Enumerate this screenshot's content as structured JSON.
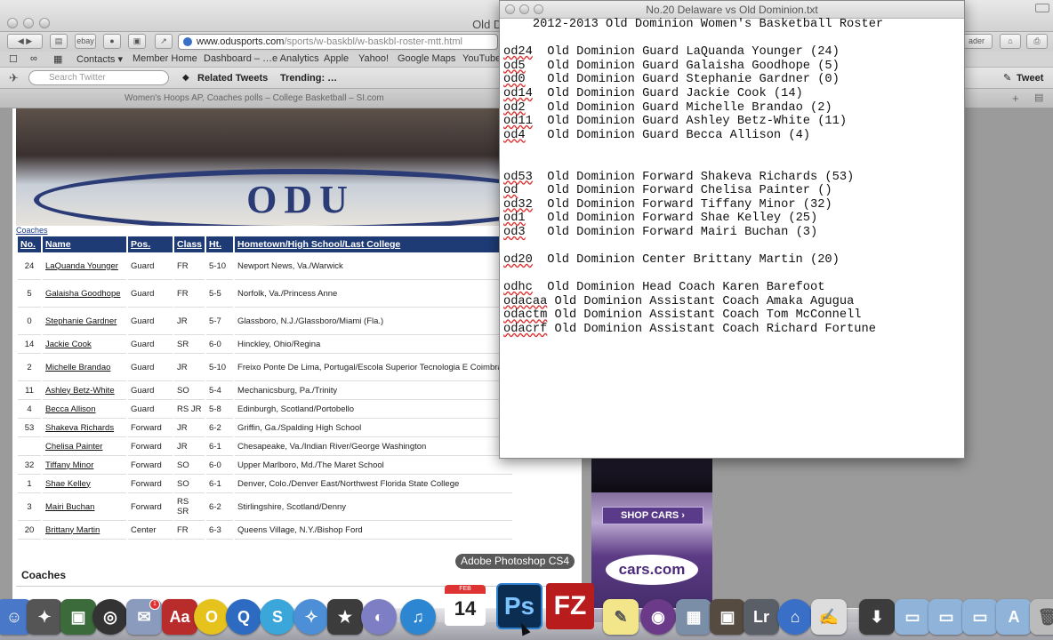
{
  "browser": {
    "window_title": "Old Dominion Official",
    "url_host": "www.odusports.com",
    "url_path": "/sports/w-baskbl/w-baskbl-roster-mtt.html",
    "bookmarks": [
      "Contacts ▾",
      "Member Home",
      "Dashboard – …e Analytics",
      "Apple",
      "Yahoo!",
      "Google Maps",
      "YouTube"
    ],
    "twitter_search_placeholder": "Search Twitter",
    "related_tweets": "Related Tweets",
    "trending": "Trending: …",
    "tweet_button": "Tweet",
    "tab_title": "Women's Hoops AP, Coaches polls – College Basketball – SI.com",
    "reader_label": "ader"
  },
  "page": {
    "coaches_link": "Coaches",
    "table_headers": [
      "No.",
      "Name",
      "Pos.",
      "Class",
      "Ht.",
      "Hometown/High School/Last College"
    ],
    "roster": [
      {
        "no": "24",
        "name": "LaQuanda Younger",
        "pos": "Guard",
        "class": "FR",
        "ht": "5-10",
        "hometown": "Newport News, Va./Warwick"
      },
      {
        "no": "5",
        "name": "Galaisha Goodhope",
        "pos": "Guard",
        "class": "FR",
        "ht": "5-5",
        "hometown": "Norfolk, Va./Princess Anne"
      },
      {
        "no": "0",
        "name": "Stephanie Gardner",
        "pos": "Guard",
        "class": "JR",
        "ht": "5-7",
        "hometown": "Glassboro, N.J./Glassboro/Miami (Fla.)"
      },
      {
        "no": "14",
        "name": "Jackie Cook",
        "pos": "Guard",
        "class": "SR",
        "ht": "6-0",
        "hometown": "Hinckley, Ohio/Regina"
      },
      {
        "no": "2",
        "name": "Michelle Brandao",
        "pos": "Guard",
        "class": "JR",
        "ht": "5-10",
        "hometown": "Freixo Ponte De Lima, Portugal/Escola Superior Tecnologia E Coimbra"
      },
      {
        "no": "11",
        "name": "Ashley Betz-White",
        "pos": "Guard",
        "class": "SO",
        "ht": "5-4",
        "hometown": "Mechanicsburg, Pa./Trinity"
      },
      {
        "no": "4",
        "name": "Becca Allison",
        "pos": "Guard",
        "class": "RS JR",
        "ht": "5-8",
        "hometown": "Edinburgh, Scotland/Portobello"
      },
      {
        "no": "53",
        "name": "Shakeva Richards",
        "pos": "Forward",
        "class": "JR",
        "ht": "6-2",
        "hometown": "Griffin, Ga./Spalding High School"
      },
      {
        "no": "",
        "name": "Chelisa Painter",
        "pos": "Forward",
        "class": "JR",
        "ht": "6-1",
        "hometown": "Chesapeake, Va./Indian River/George Washington"
      },
      {
        "no": "32",
        "name": "Tiffany Minor",
        "pos": "Forward",
        "class": "SO",
        "ht": "6-0",
        "hometown": "Upper Marlboro, Md./The Maret School"
      },
      {
        "no": "1",
        "name": "Shae Kelley",
        "pos": "Forward",
        "class": "SO",
        "ht": "6-1",
        "hometown": "Denver, Colo./Denver East/Northwest Florida State College"
      },
      {
        "no": "3",
        "name": "Mairi Buchan",
        "pos": "Forward",
        "class": "RS SR",
        "ht": "6-2",
        "hometown": "Stirlingshire, Scotland/Denny"
      },
      {
        "no": "20",
        "name": "Brittany Martin",
        "pos": "Center",
        "class": "FR",
        "ht": "6-3",
        "hometown": "Queens Village, N.Y./Bishop Ford"
      }
    ],
    "coaches_heading": "Coaches",
    "ad_button": "SHOP CARS ›",
    "ad_logo": "cars.com"
  },
  "editor": {
    "title": "No.20 Delaware vs Old Dominion.txt",
    "lines": [
      {
        "text": "    2012-2013 Old Dominion Women's Basketball Roster",
        "code": ""
      },
      {
        "text": "",
        "code": ""
      },
      {
        "code": "od24",
        "text": "  Old Dominion Guard LaQuanda Younger (24)"
      },
      {
        "code": "od5",
        "text": "   Old Dominion Guard Galaisha Goodhope (5)"
      },
      {
        "code": "od0",
        "text": "   Old Dominion Guard Stephanie Gardner (0)"
      },
      {
        "code": "od14",
        "text": "  Old Dominion Guard Jackie Cook (14)"
      },
      {
        "code": "od2",
        "text": "   Old Dominion Guard Michelle Brandao (2)"
      },
      {
        "code": "od11",
        "text": "  Old Dominion Guard Ashley Betz-White (11)"
      },
      {
        "code": "od4",
        "text": "   Old Dominion Guard Becca Allison (4)"
      },
      {
        "text": "",
        "code": ""
      },
      {
        "text": "",
        "code": ""
      },
      {
        "code": "od53",
        "text": "  Old Dominion Forward Shakeva Richards (53)"
      },
      {
        "code": "od",
        "text": "    Old Dominion Forward Chelisa Painter ()"
      },
      {
        "code": "od32",
        "text": "  Old Dominion Forward Tiffany Minor (32)"
      },
      {
        "code": "od1",
        "text": "   Old Dominion Forward Shae Kelley (25)"
      },
      {
        "code": "od3",
        "text": "   Old Dominion Forward Mairi Buchan (3)"
      },
      {
        "text": "",
        "code": ""
      },
      {
        "code": "od20",
        "text": "  Old Dominion Center Brittany Martin (20)"
      },
      {
        "text": "",
        "code": ""
      },
      {
        "code": "odhc",
        "text": "  Old Dominion Head Coach Karen Barefoot"
      },
      {
        "code": "odacaa",
        "text": " Old Dominion Assistant Coach Amaka Agugua"
      },
      {
        "code": "odactm",
        "text": " Old Dominion Assistant Coach Tom McConnell"
      },
      {
        "code": "odacrf",
        "text": " Old Dominion Assistant Coach Richard Fortune"
      }
    ]
  },
  "dock": {
    "tooltip": "Adobe Photoshop CS4",
    "calendar_month": "FEB",
    "calendar_day": "14",
    "photoshop_label": "Ps",
    "filezilla_label": "FZ",
    "lightroom_label": "Lr",
    "mail_badge": "1"
  }
}
